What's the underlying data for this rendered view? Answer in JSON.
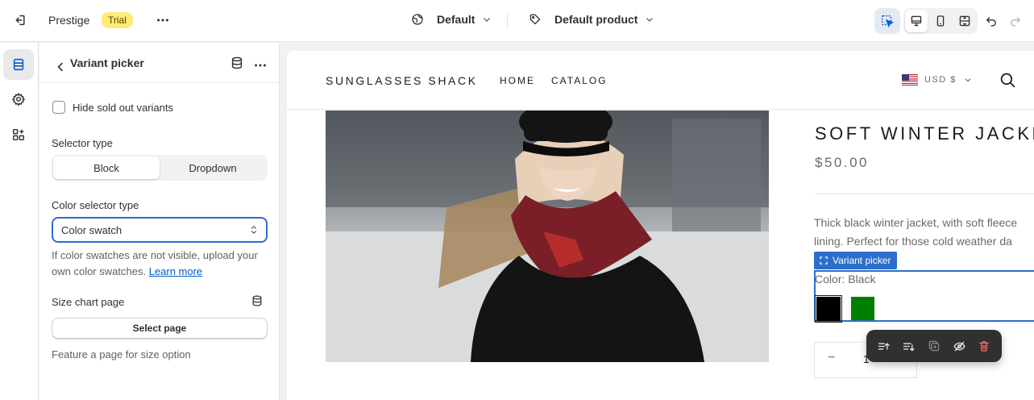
{
  "topbar": {
    "store_name": "Prestige",
    "trial_badge": "Trial",
    "theme_selector": "Default",
    "template_selector": "Default product",
    "colors": {
      "trial_badge_bg": "#ffeb78",
      "selected_tool_bg": "#e3e9f5"
    }
  },
  "panel": {
    "title": "Variant picker",
    "hide_sold_out_label": "Hide sold out variants",
    "hide_sold_out_checked": false,
    "selector_type_label": "Selector type",
    "selector_type_options": [
      "Block",
      "Dropdown"
    ],
    "selector_type_selected": "Block",
    "color_selector_label": "Color selector type",
    "color_selector_value": "Color swatch",
    "help_text": "If color swatches are not visible, upload your own color swatches.",
    "help_link": "Learn more",
    "size_chart_label": "Size chart page",
    "select_page_button": "Select page",
    "size_chart_help": "Feature a page for size option"
  },
  "store": {
    "name": "SUNGLASSES SHACK",
    "nav": [
      "HOME",
      "CATALOG"
    ],
    "currency": "USD $",
    "product_title": "SOFT WINTER JACKET",
    "price": "$50.00",
    "description_line1": "Thick black winter jacket, with soft fleece",
    "description_line2": "lining. Perfect for those cold weather da",
    "block_tag": "Variant picker",
    "color_label": "Color: Black",
    "swatches": [
      {
        "name": "Black",
        "color": "#000000",
        "selected": true
      },
      {
        "name": "Green",
        "color": "#008000",
        "selected": false
      }
    ],
    "qty_minus": "−",
    "qty_value": "1"
  },
  "accent_color": "#2c6ecb"
}
